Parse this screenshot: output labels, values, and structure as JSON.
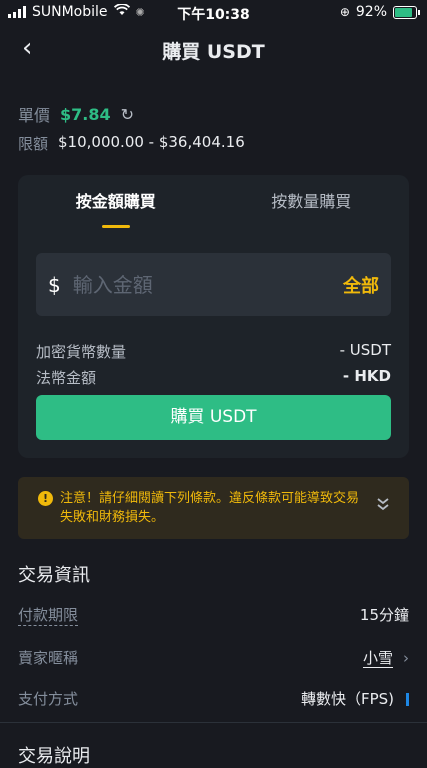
{
  "status": {
    "carrier": "SUNMobile",
    "time": "下午10:38",
    "battery": "92%",
    "battery_level": 0.92
  },
  "header": {
    "back_icon": "‹",
    "title": "購買 USDT"
  },
  "price": {
    "label": "單價",
    "value": "$7.84"
  },
  "limit": {
    "label": "限額",
    "value": "$10,000.00 - $36,404.16"
  },
  "tabs": [
    {
      "label": "按金額購買"
    },
    {
      "label": "按數量購買"
    }
  ],
  "input": {
    "currency": "$",
    "placeholder": "輸入金額",
    "all_label": "全部"
  },
  "crypto_amount": {
    "label": "加密貨幣數量",
    "value": "- USDT"
  },
  "fiat_amount": {
    "label": "法幣金額",
    "value": "- HKD"
  },
  "buy_button": {
    "label": "購買 USDT"
  },
  "warning": {
    "text": "注意！請仔細閱讀下列條款。違反條款可能導致交易失敗和財務損失。"
  },
  "trade_info": {
    "title": "交易資訊",
    "payment_limit": {
      "label": "付款期限",
      "value": "15分鐘"
    },
    "seller": {
      "label": "賣家暱稱",
      "value": "小雪"
    },
    "payment_method": {
      "label": "支付方式",
      "value": "轉數快（FPS)"
    }
  },
  "trade_notes": {
    "title": "交易說明"
  },
  "colors": {
    "background": "#181a20",
    "green": "#2ebd85",
    "yellow": "#f0b90b",
    "card": "#1e2329"
  }
}
